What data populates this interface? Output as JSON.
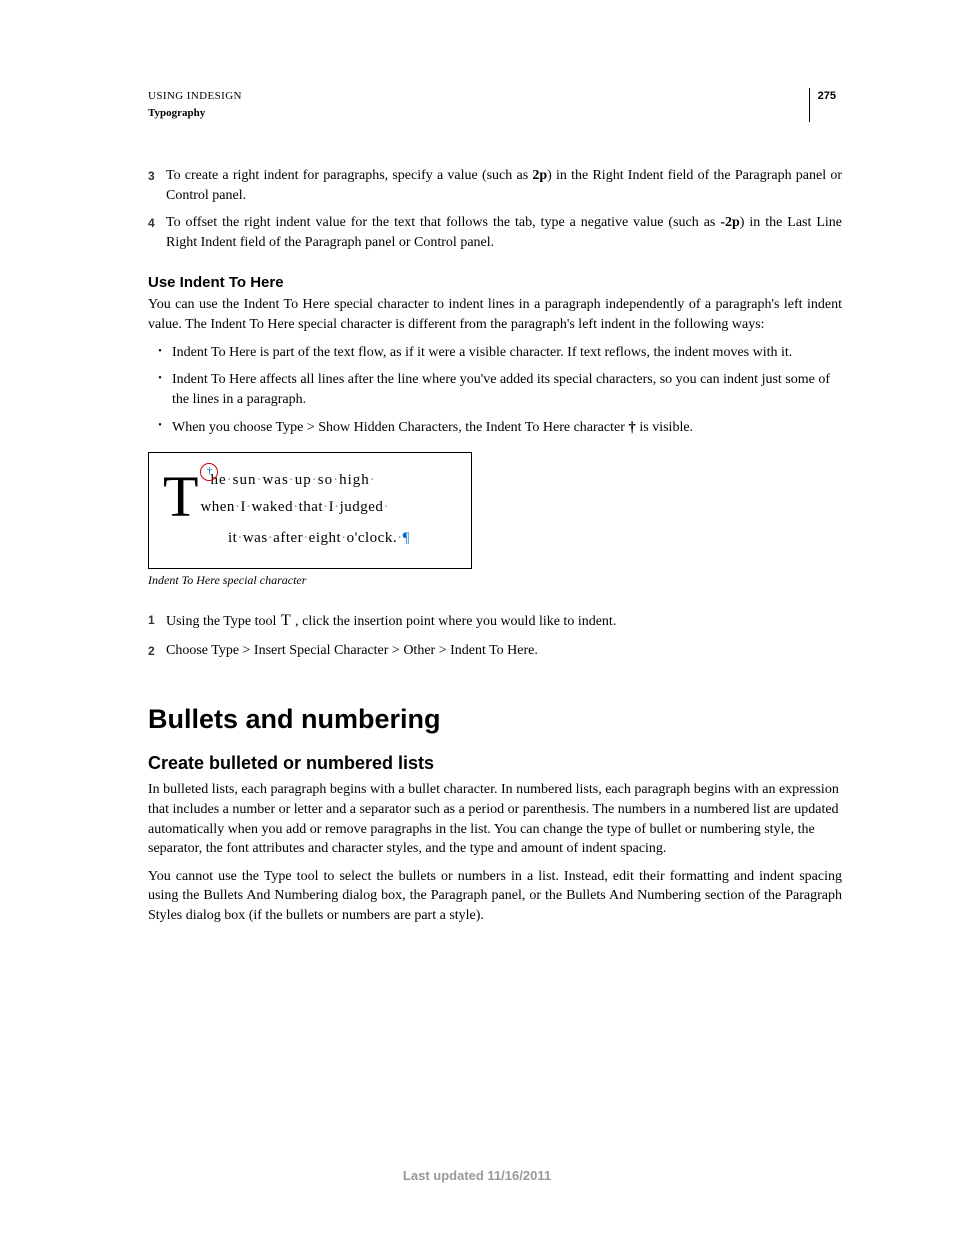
{
  "header": {
    "doc_title": "USING INDESIGN",
    "section": "Typography",
    "page_number": "275"
  },
  "steps_top": [
    {
      "n": "3",
      "before": "To create a right indent for paragraphs, specify a value (such as ",
      "bold": "2p",
      "after": ") in the Right Indent field of the Paragraph panel or Control panel."
    },
    {
      "n": "4",
      "before": "To offset the right indent value for the text that follows the tab, type a negative value (such as ",
      "bold": "-2p",
      "after": ") in the Last Line Right Indent field of the Paragraph panel or Control panel."
    }
  ],
  "section1": {
    "heading": "Use Indent To Here",
    "intro": "You can use the Indent To Here special character to indent lines in a paragraph independently of a paragraph's left indent value. The Indent To Here special character is different from the paragraph's left indent in the following ways:",
    "bullets": [
      "Indent To Here is part of the text flow, as if it were a visible character. If text reflows, the indent moves with it.",
      "Indent To Here affects all lines after the line where you've added its special characters, so you can indent just some of the lines in a paragraph.",
      {
        "pre": "When you choose Type > Show Hidden Characters, the Indent To Here character ",
        "icon": "†",
        "post": " is visible."
      }
    ]
  },
  "figure": {
    "dropcap": "T",
    "line1_rest": "he sun was up so high",
    "line2": "when I waked that I judged",
    "line3": "it was after eight o'clock.",
    "caption": "Indent To Here special character"
  },
  "steps_bottom": [
    {
      "n": "1",
      "pre": "Using the Type tool ",
      "icon": "T",
      "post": " , click the insertion point where you would like to indent."
    },
    {
      "n": "2",
      "text": "Choose Type > Insert Special Character > Other > Indent To Here."
    }
  ],
  "section2": {
    "h1": "Bullets and numbering",
    "h2": "Create bulleted or numbered lists",
    "p1": "In bulleted lists, each paragraph begins with a bullet character. In numbered lists, each paragraph begins with an expression that includes a number or letter and a separator such as a period or parenthesis. The numbers in a numbered list are updated automatically when you add or remove paragraphs in the list. You can change the type of bullet or numbering style, the separator, the font attributes and character styles, and the type and amount of indent spacing.",
    "p2": "You cannot use the Type tool to select the bullets or numbers in a list. Instead, edit their formatting and indent spacing using the Bullets And Numbering dialog box, the Paragraph panel, or the Bullets And Numbering section of the Paragraph Styles dialog box (if the bullets or numbers are part a style)."
  },
  "footer": "Last updated 11/16/2011"
}
